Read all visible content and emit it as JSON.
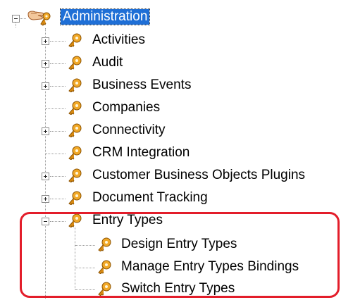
{
  "tree": {
    "root": {
      "label": "Administration",
      "expanded": true,
      "selected": true,
      "icon": "hand-key-icon"
    },
    "items": [
      {
        "label": "Activities",
        "expander": "plus",
        "icon": "key-icon"
      },
      {
        "label": "Audit",
        "expander": "plus",
        "icon": "key-icon"
      },
      {
        "label": "Business Events",
        "expander": "plus",
        "icon": "key-icon"
      },
      {
        "label": "Companies",
        "expander": "none",
        "icon": "key-icon"
      },
      {
        "label": "Connectivity",
        "expander": "plus",
        "icon": "key-icon"
      },
      {
        "label": "CRM Integration",
        "expander": "none",
        "icon": "key-icon"
      },
      {
        "label": "Customer Business Objects Plugins",
        "expander": "plus",
        "icon": "key-icon"
      },
      {
        "label": "Document Tracking",
        "expander": "plus",
        "icon": "key-icon"
      },
      {
        "label": "Entry Types",
        "expander": "minus",
        "icon": "key-icon",
        "children": [
          {
            "label": "Design Entry Types",
            "icon": "key-icon"
          },
          {
            "label": "Manage Entry Types Bindings",
            "icon": "key-icon"
          },
          {
            "label": "Switch Entry Types",
            "icon": "key-icon"
          }
        ]
      }
    ]
  },
  "colors": {
    "selection": "#1f6fd6",
    "highlight_border": "#e31d2a",
    "key": "#d88a12"
  }
}
